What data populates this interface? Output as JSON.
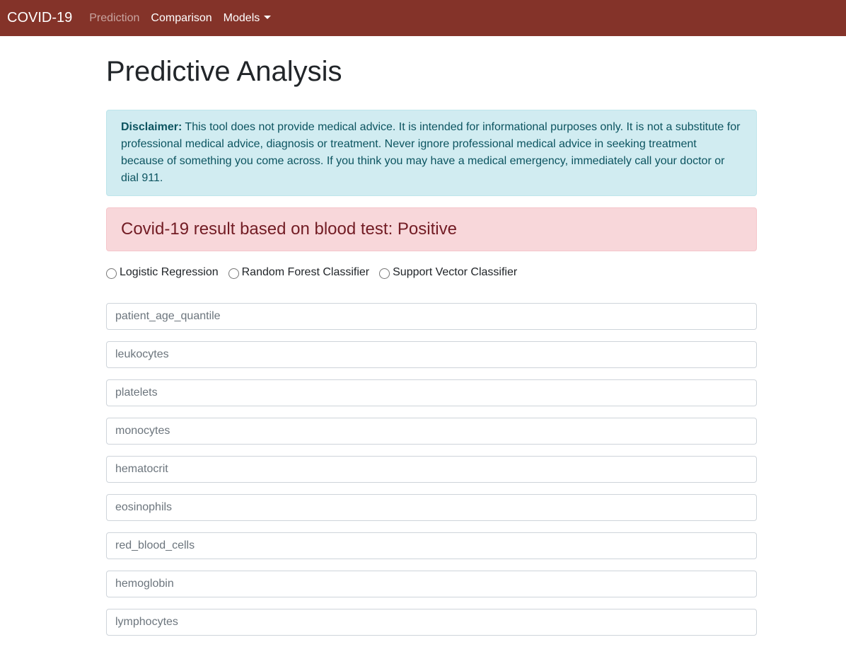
{
  "navbar": {
    "brand": "COVID-19",
    "items": [
      {
        "label": "Prediction"
      },
      {
        "label": "Comparison"
      },
      {
        "label": "Models"
      }
    ]
  },
  "page": {
    "title": "Predictive Analysis"
  },
  "disclaimer": {
    "label": "Disclaimer:",
    "text": " This tool does not provide medical advice. It is intended for informational purposes only. It is not a substitute for professional medical advice, diagnosis or treatment. Never ignore professional medical advice in seeking treatment because of something you come across. If you think you may have a medical emergency, immediately call your doctor or dial 911."
  },
  "result": {
    "text": "Covid-19 result based on blood test: Positive"
  },
  "models": [
    {
      "label": "Logistic Regression"
    },
    {
      "label": "Random Forest Classifier"
    },
    {
      "label": "Support Vector Classifier"
    }
  ],
  "fields": [
    {
      "placeholder": "patient_age_quantile"
    },
    {
      "placeholder": "leukocytes"
    },
    {
      "placeholder": "platelets"
    },
    {
      "placeholder": "monocytes"
    },
    {
      "placeholder": "hematocrit"
    },
    {
      "placeholder": "eosinophils"
    },
    {
      "placeholder": "red_blood_cells"
    },
    {
      "placeholder": "hemoglobin"
    },
    {
      "placeholder": "lymphocytes"
    }
  ],
  "colors": {
    "navbar": "#843329",
    "info_bg": "#d1ecf1",
    "danger_bg": "#f8d7da",
    "danger_text": "#721c24"
  }
}
